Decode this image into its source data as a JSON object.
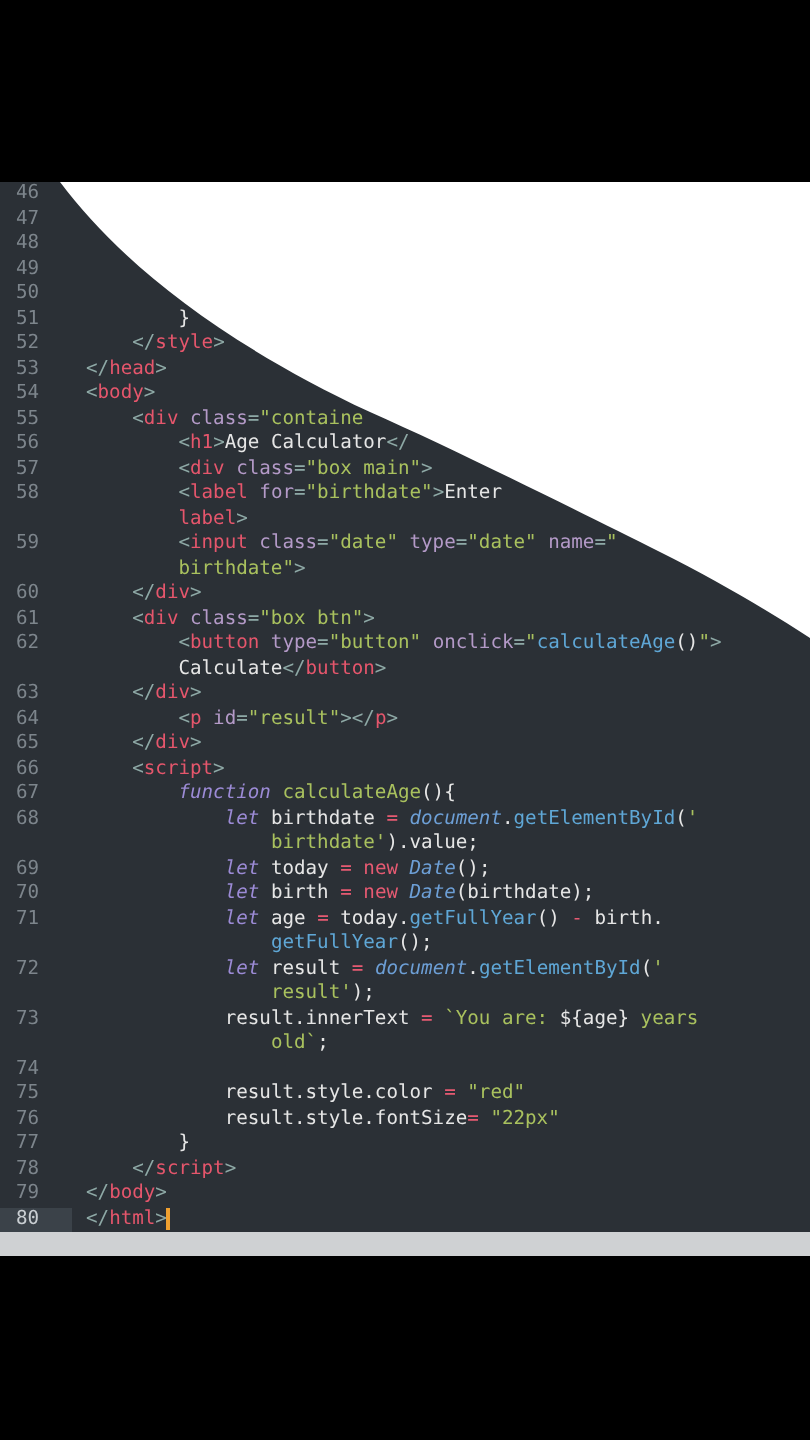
{
  "editor": {
    "lines": [
      {
        "number": "46",
        "current": false,
        "kind": "flush"
      },
      {
        "number": "47",
        "current": false,
        "kind": "flush"
      },
      {
        "number": "48",
        "current": false,
        "kind": "flush"
      },
      {
        "number": "49",
        "current": false,
        "kind": "flush"
      },
      {
        "number": "50",
        "current": false,
        "kind": "flush"
      },
      {
        "number": "51",
        "current": false,
        "kind": "indent2",
        "tokens": [
          {
            "kind": "text",
            "text": "}"
          }
        ]
      },
      {
        "number": "52",
        "current": false,
        "kind": "indent1",
        "tokens": [
          {
            "kind": "punct",
            "text": "</"
          },
          {
            "kind": "tag",
            "text": "style"
          },
          {
            "kind": "punct",
            "text": ">"
          }
        ]
      },
      {
        "number": "53",
        "current": false,
        "kind": "flush",
        "tokens": [
          {
            "kind": "punct",
            "text": "</"
          },
          {
            "kind": "tag",
            "text": "head"
          },
          {
            "kind": "punct",
            "text": ">"
          }
        ]
      },
      {
        "number": "54",
        "current": false,
        "kind": "flush",
        "tokens": [
          {
            "kind": "punct",
            "text": "<"
          },
          {
            "kind": "tag",
            "text": "body"
          },
          {
            "kind": "punct",
            "text": ">"
          }
        ]
      },
      {
        "number": "55",
        "current": false,
        "kind": "indent1",
        "tokens": [
          {
            "kind": "punct",
            "text": "<"
          },
          {
            "kind": "tag",
            "text": "div"
          },
          {
            "kind": "attr",
            "text": " class"
          },
          {
            "kind": "punct",
            "text": "="
          },
          {
            "kind": "string",
            "text": "\"containe"
          }
        ]
      },
      {
        "number": "56",
        "current": false,
        "kind": "indent2",
        "tokens": [
          {
            "kind": "punct",
            "text": "<"
          },
          {
            "kind": "tag",
            "text": "h1"
          },
          {
            "kind": "punct",
            "text": ">"
          },
          {
            "kind": "text",
            "text": "Age Calculator"
          },
          {
            "kind": "punct",
            "text": "</"
          }
        ]
      },
      {
        "number": "57",
        "current": false,
        "kind": "indent2",
        "tokens": [
          {
            "kind": "punct",
            "text": "<"
          },
          {
            "kind": "tag",
            "text": "div"
          },
          {
            "kind": "attr",
            "text": " class"
          },
          {
            "kind": "punct",
            "text": "="
          },
          {
            "kind": "string",
            "text": "\"box main\""
          },
          {
            "kind": "punct",
            "text": ">"
          }
        ]
      },
      {
        "number": "58",
        "current": false,
        "kind": "indent2",
        "tokens": [
          {
            "kind": "punct",
            "text": "<"
          },
          {
            "kind": "tag",
            "text": "label"
          },
          {
            "kind": "attr",
            "text": " for"
          },
          {
            "kind": "punct",
            "text": "="
          },
          {
            "kind": "string",
            "text": "\"birthdate\""
          },
          {
            "kind": "punct",
            "text": ">"
          },
          {
            "kind": "text",
            "text": "Enter"
          }
        ]
      },
      {
        "kind": "indent2",
        "tokens": [
          {
            "kind": "tag",
            "text": "label"
          },
          {
            "kind": "punct",
            "text": ">"
          }
        ]
      },
      {
        "number": "59",
        "current": false,
        "kind": "indent2",
        "tokens": [
          {
            "kind": "punct",
            "text": "<"
          },
          {
            "kind": "tag",
            "text": "input"
          },
          {
            "kind": "attr",
            "text": " class"
          },
          {
            "kind": "punct",
            "text": "="
          },
          {
            "kind": "string",
            "text": "\"date\""
          },
          {
            "kind": "attr",
            "text": " type"
          },
          {
            "kind": "punct",
            "text": "="
          },
          {
            "kind": "string",
            "text": "\"date\""
          },
          {
            "kind": "attr",
            "text": " name"
          },
          {
            "kind": "punct",
            "text": "="
          },
          {
            "kind": "string",
            "text": "\""
          }
        ]
      },
      {
        "kind": "indent2",
        "tokens": [
          {
            "kind": "string",
            "text": "birthdate\""
          },
          {
            "kind": "punct",
            "text": ">"
          }
        ]
      },
      {
        "number": "60",
        "current": false,
        "kind": "indent1",
        "tokens": [
          {
            "kind": "punct",
            "text": "</"
          },
          {
            "kind": "tag",
            "text": "div"
          },
          {
            "kind": "punct",
            "text": ">"
          }
        ]
      },
      {
        "number": "61",
        "current": false,
        "kind": "indent1",
        "tokens": [
          {
            "kind": "punct",
            "text": "<"
          },
          {
            "kind": "tag",
            "text": "div"
          },
          {
            "kind": "attr",
            "text": " class"
          },
          {
            "kind": "punct",
            "text": "="
          },
          {
            "kind": "string",
            "text": "\"box btn\""
          },
          {
            "kind": "punct",
            "text": ">"
          }
        ]
      },
      {
        "number": "62",
        "current": false,
        "kind": "indent2",
        "tokens": [
          {
            "kind": "punct",
            "text": "<"
          },
          {
            "kind": "tag",
            "text": "button"
          },
          {
            "kind": "attr",
            "text": " type"
          },
          {
            "kind": "punct",
            "text": "="
          },
          {
            "kind": "string",
            "text": "\"button\""
          },
          {
            "kind": "attr",
            "text": " onclick"
          },
          {
            "kind": "punct",
            "text": "="
          },
          {
            "kind": "string",
            "text": "\""
          },
          {
            "kind": "func",
            "text": "calculateAge"
          },
          {
            "kind": "text",
            "text": "()"
          },
          {
            "kind": "string",
            "text": "\""
          },
          {
            "kind": "punct",
            "text": ">"
          }
        ]
      },
      {
        "kind": "indent2",
        "tokens": [
          {
            "kind": "text",
            "text": "Calculate"
          },
          {
            "kind": "punct",
            "text": "</"
          },
          {
            "kind": "tag",
            "text": "button"
          },
          {
            "kind": "punct",
            "text": ">"
          }
        ]
      },
      {
        "number": "63",
        "current": false,
        "kind": "indent1",
        "tokens": [
          {
            "kind": "punct",
            "text": "</"
          },
          {
            "kind": "tag",
            "text": "div"
          },
          {
            "kind": "punct",
            "text": ">"
          }
        ]
      },
      {
        "number": "64",
        "current": false,
        "kind": "indent2",
        "tokens": [
          {
            "kind": "punct",
            "text": "<"
          },
          {
            "kind": "tag",
            "text": "p"
          },
          {
            "kind": "attr",
            "text": " id"
          },
          {
            "kind": "punct",
            "text": "="
          },
          {
            "kind": "string",
            "text": "\"result\""
          },
          {
            "kind": "punct",
            "text": "></"
          },
          {
            "kind": "tag",
            "text": "p"
          },
          {
            "kind": "punct",
            "text": ">"
          }
        ]
      },
      {
        "number": "65",
        "current": false,
        "kind": "indent1",
        "tokens": [
          {
            "kind": "punct",
            "text": "</"
          },
          {
            "kind": "tag",
            "text": "div"
          },
          {
            "kind": "punct",
            "text": ">"
          }
        ]
      },
      {
        "number": "66",
        "current": false,
        "kind": "indent1",
        "tokens": [
          {
            "kind": "punct",
            "text": "<"
          },
          {
            "kind": "tag",
            "text": "script"
          },
          {
            "kind": "punct",
            "text": ">"
          }
        ]
      },
      {
        "number": "67",
        "current": false,
        "kind": "indent2",
        "tokens": [
          {
            "kind": "keyword",
            "text": "function"
          },
          {
            "kind": "define",
            "text": " calculateAge"
          },
          {
            "kind": "text",
            "text": "(){"
          }
        ]
      },
      {
        "number": "68",
        "current": false,
        "kind": "indent3",
        "tokens": [
          {
            "kind": "keyword",
            "text": "let"
          },
          {
            "kind": "text",
            "text": " birthdate "
          },
          {
            "kind": "operator",
            "text": "="
          },
          {
            "kind": "object",
            "text": " document"
          },
          {
            "kind": "text",
            "text": "."
          },
          {
            "kind": "func",
            "text": "getElementById"
          },
          {
            "kind": "text",
            "text": "("
          },
          {
            "kind": "string",
            "text": "'"
          }
        ]
      },
      {
        "kind": "indent4",
        "tokens": [
          {
            "kind": "string",
            "text": "birthdate'"
          },
          {
            "kind": "text",
            "text": ").value;"
          }
        ]
      },
      {
        "number": "69",
        "current": false,
        "kind": "indent3",
        "tokens": [
          {
            "kind": "keyword",
            "text": "let"
          },
          {
            "kind": "text",
            "text": " today "
          },
          {
            "kind": "operator",
            "text": "="
          },
          {
            "kind": "operator",
            "text": " new"
          },
          {
            "kind": "object",
            "text": " Date"
          },
          {
            "kind": "text",
            "text": "();"
          }
        ]
      },
      {
        "number": "70",
        "current": false,
        "kind": "indent3",
        "tokens": [
          {
            "kind": "keyword",
            "text": "let"
          },
          {
            "kind": "text",
            "text": " birth "
          },
          {
            "kind": "operator",
            "text": "="
          },
          {
            "kind": "operator",
            "text": " new"
          },
          {
            "kind": "object",
            "text": " Date"
          },
          {
            "kind": "text",
            "text": "(birthdate);"
          }
        ]
      },
      {
        "number": "71",
        "current": false,
        "kind": "indent3",
        "tokens": [
          {
            "kind": "keyword",
            "text": "let"
          },
          {
            "kind": "text",
            "text": " age "
          },
          {
            "kind": "operator",
            "text": "="
          },
          {
            "kind": "text",
            "text": " today."
          },
          {
            "kind": "func",
            "text": "getFullYear"
          },
          {
            "kind": "text",
            "text": "() "
          },
          {
            "kind": "operator",
            "text": "-"
          },
          {
            "kind": "text",
            "text": " birth."
          }
        ]
      },
      {
        "kind": "indent4",
        "tokens": [
          {
            "kind": "func",
            "text": "getFullYear"
          },
          {
            "kind": "text",
            "text": "();"
          }
        ]
      },
      {
        "number": "72",
        "current": false,
        "kind": "indent3",
        "tokens": [
          {
            "kind": "keyword",
            "text": "let"
          },
          {
            "kind": "text",
            "text": " result "
          },
          {
            "kind": "operator",
            "text": "="
          },
          {
            "kind": "object",
            "text": " document"
          },
          {
            "kind": "text",
            "text": "."
          },
          {
            "kind": "func",
            "text": "getElementById"
          },
          {
            "kind": "text",
            "text": "("
          },
          {
            "kind": "string",
            "text": "'"
          }
        ]
      },
      {
        "kind": "indent4",
        "tokens": [
          {
            "kind": "string",
            "text": "result'"
          },
          {
            "kind": "text",
            "text": ");"
          }
        ]
      },
      {
        "number": "73",
        "current": false,
        "kind": "indent3",
        "tokens": [
          {
            "kind": "text",
            "text": "result.innerText "
          },
          {
            "kind": "operator",
            "text": "="
          },
          {
            "kind": "string",
            "text": " `You are: "
          },
          {
            "kind": "text",
            "text": "${age}"
          },
          {
            "kind": "string",
            "text": " years"
          }
        ]
      },
      {
        "kind": "indent4",
        "tokens": [
          {
            "kind": "string",
            "text": "old`"
          },
          {
            "kind": "text",
            "text": ";"
          }
        ]
      },
      {
        "number": "74",
        "current": false,
        "kind": "flush"
      },
      {
        "number": "75",
        "current": false,
        "kind": "indent3",
        "tokens": [
          {
            "kind": "text",
            "text": "result.style.color "
          },
          {
            "kind": "operator",
            "text": "="
          },
          {
            "kind": "string",
            "text": " \"red\""
          }
        ]
      },
      {
        "number": "76",
        "current": false,
        "kind": "indent3",
        "tokens": [
          {
            "kind": "text",
            "text": "result.style.fontSize"
          },
          {
            "kind": "operator",
            "text": "="
          },
          {
            "kind": "string",
            "text": " \"22px\""
          }
        ]
      },
      {
        "number": "77",
        "current": false,
        "kind": "indent2",
        "tokens": [
          {
            "kind": "text",
            "text": "}"
          }
        ]
      },
      {
        "number": "78",
        "current": false,
        "kind": "indent1",
        "tokens": [
          {
            "kind": "punct",
            "text": "</"
          },
          {
            "kind": "tag",
            "text": "script"
          },
          {
            "kind": "punct",
            "text": ">"
          }
        ]
      },
      {
        "number": "79",
        "current": false,
        "kind": "flush",
        "tokens": [
          {
            "kind": "punct",
            "text": "</"
          },
          {
            "kind": "tag",
            "text": "body"
          },
          {
            "kind": "punct",
            "text": ">"
          }
        ]
      },
      {
        "number": "80",
        "current": true,
        "kind": "flush",
        "tokens": [
          {
            "kind": "punct",
            "text": "</"
          },
          {
            "kind": "tag",
            "text": "html"
          },
          {
            "kind": "punct",
            "text": ">"
          }
        ]
      }
    ]
  }
}
